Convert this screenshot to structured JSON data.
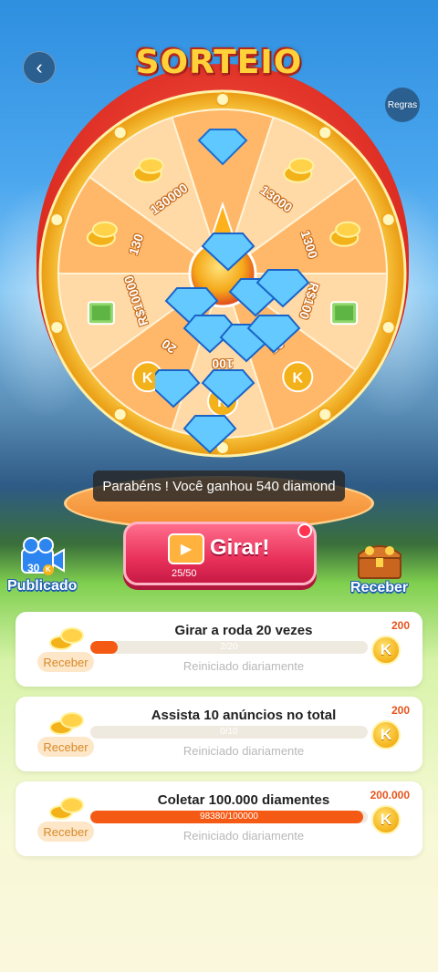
{
  "header": {
    "title": "SORTEIO",
    "back_icon": "chevron-left-icon",
    "rules_label": "Regras"
  },
  "wheel": {
    "segments": [
      {
        "label": "",
        "icon": "diamond-icon"
      },
      {
        "label": "13000",
        "icon": "coin-stack-icon"
      },
      {
        "label": "1300",
        "icon": "coin-stack-icon"
      },
      {
        "label": "R$100",
        "icon": "cash-stack-icon"
      },
      {
        "label": "25",
        "icon": "k-coin-icon"
      },
      {
        "label": "100",
        "icon": "k-coin-icon"
      },
      {
        "label": "20",
        "icon": "k-coin-icon"
      },
      {
        "label": "R$10000",
        "icon": "cash-stack-icon"
      },
      {
        "label": "130",
        "icon": "coin-stack-icon"
      },
      {
        "label": "130000",
        "icon": "coin-stack-icon"
      }
    ],
    "colors": {
      "segment_a": "#ffb86a",
      "segment_b": "#ffd9a6",
      "rim": "#f7b21e",
      "outer": "#d7261d"
    }
  },
  "toast": "Parabéns ! Você ganhou 540 diamond",
  "spin": {
    "label": "Girar!",
    "count": "25/50",
    "progress": 0.5
  },
  "left_side": {
    "label": "Publicado",
    "count": "30",
    "icon": "video-camera-icon"
  },
  "right_side": {
    "label": "Receber",
    "icon": "treasure-chest-icon"
  },
  "tasks": [
    {
      "name": "Girar a roda  20  vezes",
      "progress_text": "2/20",
      "progress": 0.1,
      "reset": "Reiniciado diariamente",
      "reward": "200",
      "receber": "Receber"
    },
    {
      "name": "Assista 10 anúncios no total",
      "progress_text": "0/10",
      "progress": 0.0,
      "reset": "Reiniciado diariamente",
      "reward": "200",
      "receber": "Receber"
    },
    {
      "name": "Coletar 100.000 diamentes",
      "progress_text": "98380/100000",
      "progress": 0.9838,
      "reset": "Reiniciado diariamente",
      "reward": "200.000",
      "receber": "Receber"
    }
  ],
  "coin_letter": "K"
}
